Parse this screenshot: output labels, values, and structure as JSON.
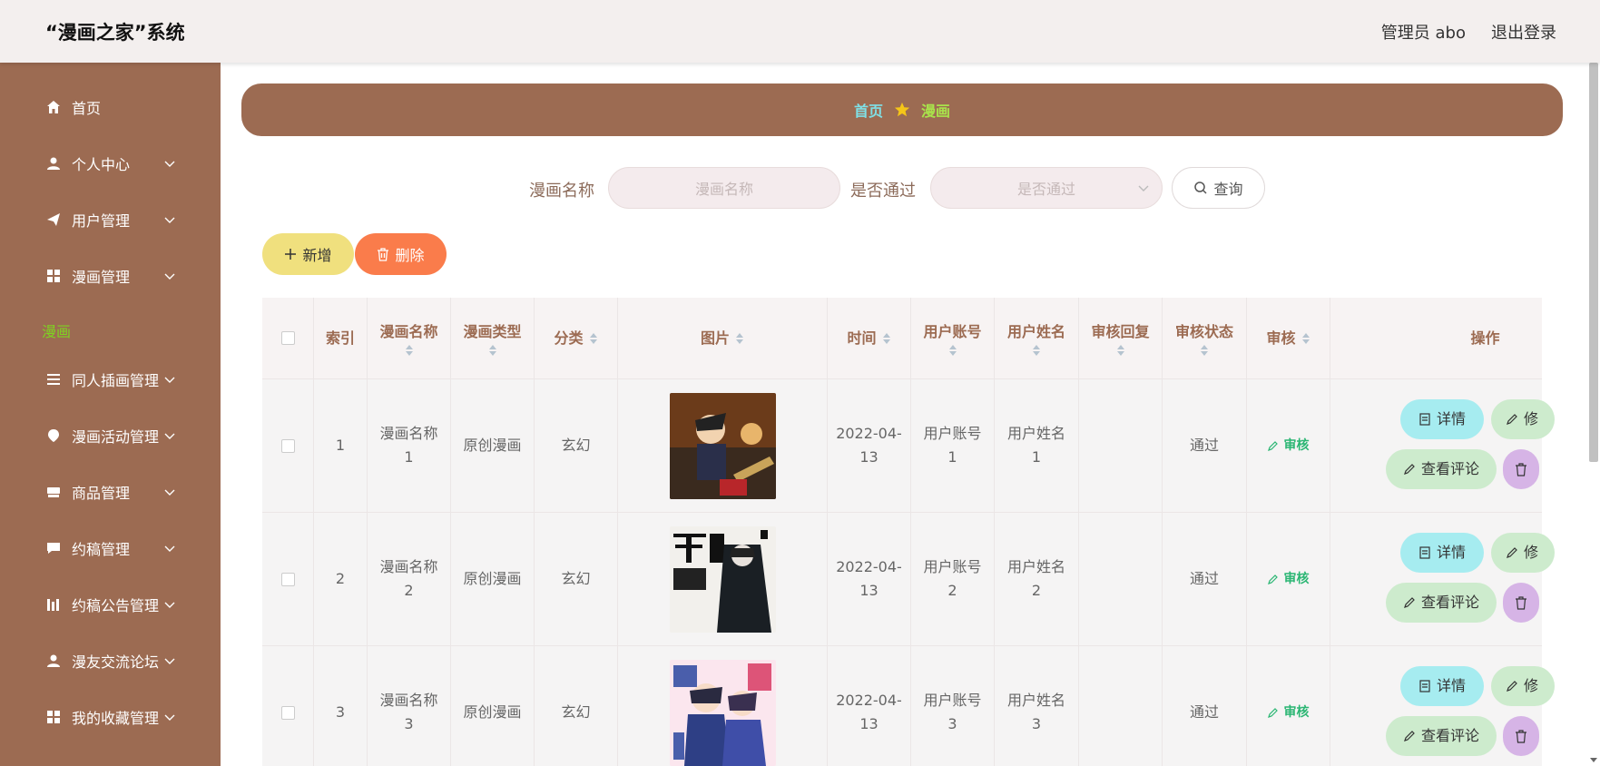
{
  "header": {
    "title": "“漫画之家”系统",
    "user": "管理员 abo",
    "logout": "退出登录"
  },
  "sidebar": {
    "items": [
      {
        "label": "首页",
        "icon": "home-icon"
      },
      {
        "label": "个人中心",
        "icon": "user-icon"
      },
      {
        "label": "用户管理",
        "icon": "send-icon"
      },
      {
        "label": "漫画管理",
        "icon": "grid-icon"
      },
      {
        "label": "同人插画管理",
        "icon": "list-icon"
      },
      {
        "label": "漫画活动管理",
        "icon": "location-icon"
      },
      {
        "label": "商品管理",
        "icon": "shop-icon"
      },
      {
        "label": "约稿管理",
        "icon": "chat-icon"
      },
      {
        "label": "约稿公告管理",
        "icon": "chart-icon"
      },
      {
        "label": "漫友交流论坛",
        "icon": "user-icon"
      },
      {
        "label": "我的收藏管理",
        "icon": "grid-icon"
      }
    ],
    "active_sub": "漫画"
  },
  "breadcrumb": {
    "home": "首页",
    "current": "漫画"
  },
  "search": {
    "name_label": "漫画名称",
    "name_placeholder": "漫画名称",
    "pass_label": "是否通过",
    "pass_placeholder": "是否通过",
    "query_label": "查询"
  },
  "actions": {
    "add": "新增",
    "delete": "删除"
  },
  "table": {
    "headers": [
      "索引",
      "漫画名称",
      "漫画类型",
      "分类",
      "图片",
      "时间",
      "用户账号",
      "用户姓名",
      "审核回复",
      "审核状态",
      "审核",
      "操作"
    ],
    "rows": [
      {
        "index": "1",
        "name": "漫画名称1",
        "type": "原创漫画",
        "category": "玄幻",
        "time": "2022-04-13",
        "account": "用户账号1",
        "username": "用户姓名1",
        "reply": "",
        "status": "通过",
        "audit": "审核"
      },
      {
        "index": "2",
        "name": "漫画名称2",
        "type": "原创漫画",
        "category": "玄幻",
        "time": "2022-04-13",
        "account": "用户账号2",
        "username": "用户姓名2",
        "reply": "",
        "status": "通过",
        "audit": "审核"
      },
      {
        "index": "3",
        "name": "漫画名称3",
        "type": "原创漫画",
        "category": "玄幻",
        "time": "2022-04-13",
        "account": "用户账号3",
        "username": "用户姓名3",
        "reply": "",
        "status": "通过",
        "audit": "审核"
      }
    ],
    "row_actions": {
      "detail": "详情",
      "edit": "修",
      "comment": "查看评论"
    },
    "cover_images": [
      "comic-cover-1",
      "comic-cover-2",
      "comic-cover-3"
    ]
  },
  "colors": {
    "sidebar": "#9c6b52",
    "accent_green": "#7ed321",
    "breadcrumb_home": "#7fe0e6"
  }
}
